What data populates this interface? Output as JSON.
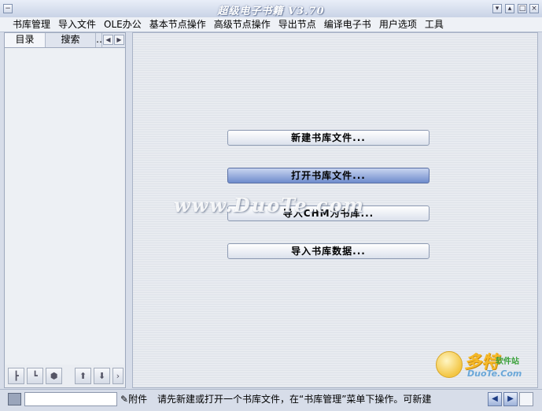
{
  "window": {
    "title": "超级电子书籍 V3.70",
    "controls": [
      "restore",
      "minimize",
      "maximize",
      "close"
    ]
  },
  "menu": [
    "书库管理",
    "导入文件",
    "OLE办公",
    "基本节点操作",
    "高级节点操作",
    "导出节点",
    "编译电子书",
    "用户选项",
    "工具"
  ],
  "left_panel": {
    "tabs": [
      "目录",
      "搜索",
      "…"
    ],
    "toolbar_icons": [
      "expand-tree-icon",
      "collapse-tree-icon",
      "delete-node-icon",
      "move-up-icon",
      "move-down-icon"
    ]
  },
  "main": {
    "buttons": [
      {
        "label": "新建书库文件...",
        "highlighted": false
      },
      {
        "label": "打开书库文件...",
        "highlighted": true
      },
      {
        "label": "导入CHM为书库...",
        "highlighted": false
      },
      {
        "label": "导入书库数据...",
        "highlighted": false
      }
    ],
    "watermark": "www.DuoTe.com"
  },
  "status": {
    "attach_label": "附件",
    "message": "请先新建或打开一个书库文件，在“书库管理”菜单下操作。可新建"
  },
  "logo": {
    "main": "多特",
    "sub": "软件站",
    "en": "DuoTe.Com"
  },
  "colors": {
    "highlight_button": "#6f8ccc",
    "background": "#d7dde9"
  }
}
